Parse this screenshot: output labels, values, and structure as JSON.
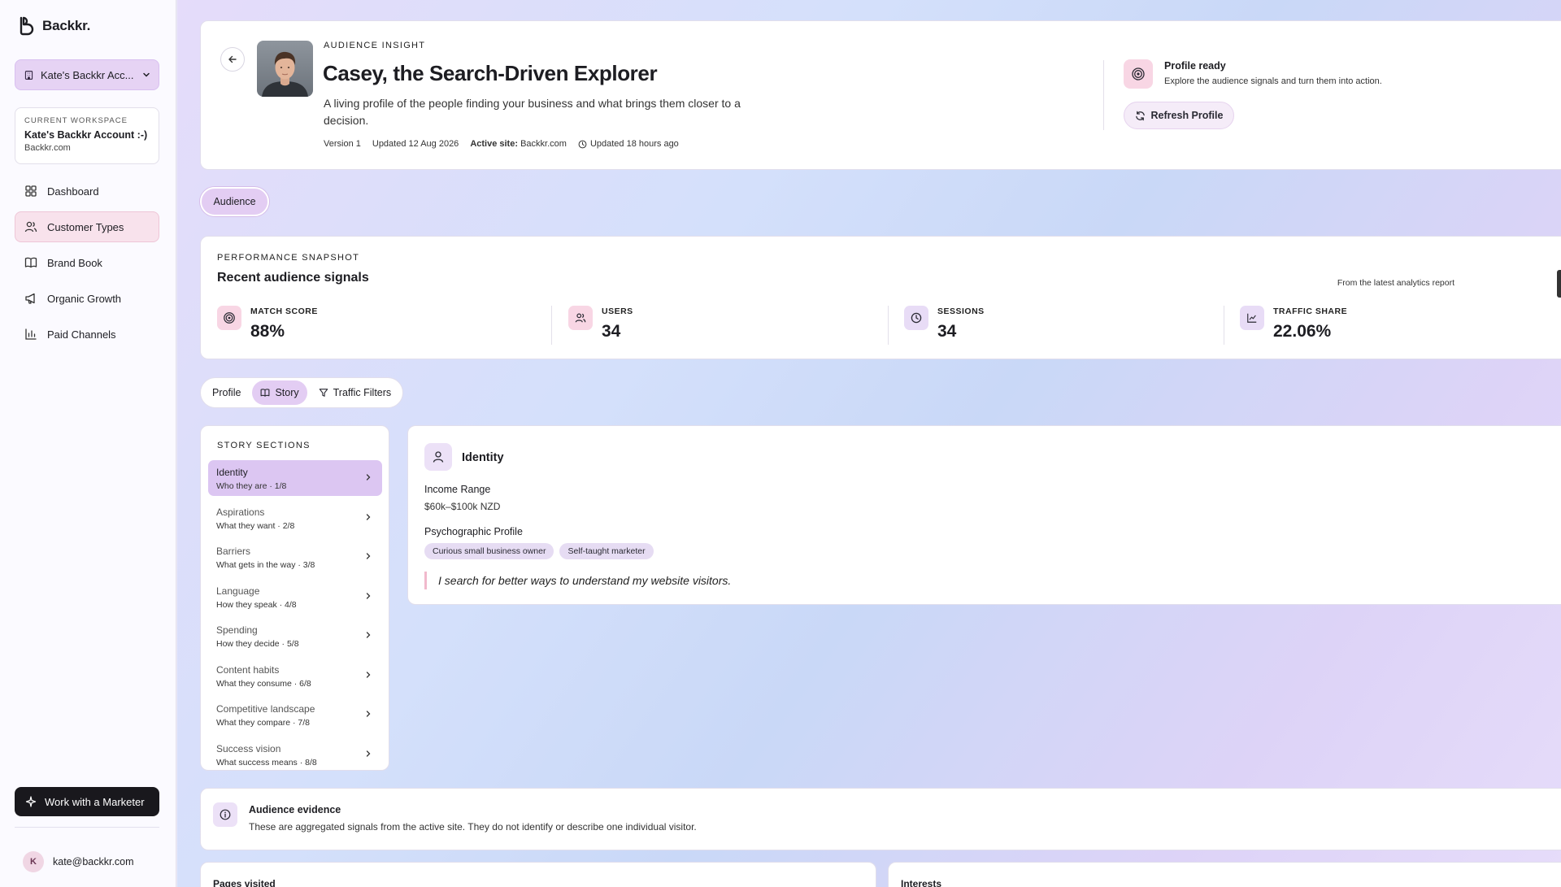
{
  "brand": {
    "name": "Backkr."
  },
  "sidebar": {
    "account_select": "Kate's Backkr Acc...",
    "workspace": {
      "eyebrow": "CURRENT WORKSPACE",
      "name": "Kate's Backkr Account :-)",
      "site": "Backkr.com"
    },
    "nav": [
      {
        "label": "Dashboard",
        "icon": "dashboard-icon",
        "active": false
      },
      {
        "label": "Customer Types",
        "icon": "users-icon",
        "active": true
      },
      {
        "label": "Brand Book",
        "icon": "book-icon",
        "active": false
      },
      {
        "label": "Organic Growth",
        "icon": "megaphone-icon",
        "active": false
      },
      {
        "label": "Paid Channels",
        "icon": "bar-chart-icon",
        "active": false
      }
    ],
    "marketer_button": "Work with a Marketer",
    "user": {
      "initial": "K",
      "email": "kate@backkr.com"
    }
  },
  "header": {
    "eyebrow": "AUDIENCE INSIGHT",
    "title": "Casey, the Search-Driven Explorer",
    "description": "A living profile of the people finding your business and what brings them closer to a decision.",
    "version": "Version 1",
    "updated": "Updated 12 Aug 2026",
    "active_site_label": "Active site:",
    "active_site": "Backkr.com",
    "updated_ago": "Updated 18 hours ago",
    "status_title": "Profile ready",
    "status_sub": "Explore the audience signals and turn them into action.",
    "refresh_label": "Refresh Profile"
  },
  "audience_pill": "Audience",
  "performance": {
    "eyebrow": "PERFORMANCE SNAPSHOT",
    "title": "Recent audience signals",
    "note": "From the latest analytics report",
    "stats": [
      {
        "label": "MATCH SCORE",
        "value": "88%",
        "icon": "target-icon",
        "color": "#f8d6e4"
      },
      {
        "label": "USERS",
        "value": "34",
        "icon": "users-icon",
        "color": "#f8d6e4"
      },
      {
        "label": "SESSIONS",
        "value": "34",
        "icon": "clock-icon",
        "color": "#e8dcf6"
      },
      {
        "label": "TRAFFIC SHARE",
        "value": "22.06%",
        "icon": "trend-icon",
        "color": "#e8dcf6"
      }
    ]
  },
  "tabs": [
    {
      "label": "Profile",
      "active": false
    },
    {
      "label": "Story",
      "active": true
    },
    {
      "label": "Traffic Filters",
      "active": false
    }
  ],
  "story": {
    "eyebrow": "STORY SECTIONS",
    "sections": [
      {
        "title": "Identity",
        "sub": "Who they are · 1/8",
        "active": true
      },
      {
        "title": "Aspirations",
        "sub": "What they want · 2/8",
        "active": false
      },
      {
        "title": "Barriers",
        "sub": "What gets in the way · 3/8",
        "active": false
      },
      {
        "title": "Language",
        "sub": "How they speak · 4/8",
        "active": false
      },
      {
        "title": "Spending",
        "sub": "How they decide · 5/8",
        "active": false
      },
      {
        "title": "Content habits",
        "sub": "What they consume · 6/8",
        "active": false
      },
      {
        "title": "Competitive landscape",
        "sub": "What they compare · 7/8",
        "active": false
      },
      {
        "title": "Success vision",
        "sub": "What success means · 8/8",
        "active": false
      }
    ]
  },
  "identity": {
    "title": "Identity",
    "income_label": "Income Range",
    "income_value": "$60k–$100k NZD",
    "psycho_label": "Psychographic Profile",
    "tags": [
      "Curious small business owner",
      "Self-taught marketer"
    ],
    "quote": "I search for better ways to understand my website visitors."
  },
  "evidence": {
    "title": "Audience evidence",
    "text": "These are aggregated signals from the active site. They do not identify or describe one individual visitor."
  },
  "bottom": {
    "pages_title": "Pages visited",
    "interests_title": "Interests"
  }
}
